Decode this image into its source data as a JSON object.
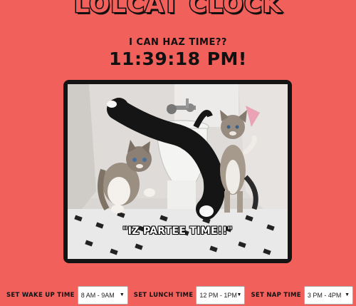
{
  "app": {
    "title": "LOLCAT CLOCK"
  },
  "header": {
    "subtitle": "I CAN HAZ TIME??",
    "time": "11:39:18 PM!"
  },
  "photo": {
    "caption": "\"IZ PARTEE TIME!!\""
  },
  "controls": {
    "wake": {
      "label": "SET WAKE UP TIME",
      "value": "8 AM - 9AM"
    },
    "lunch": {
      "label": "SET LUNCH TIME",
      "value": "12 PM - 1PM"
    },
    "nap": {
      "label": "SET NAP TIME",
      "value": "3 PM - 4PM"
    }
  },
  "colors": {
    "background": "#f2605b",
    "frame": "#141414",
    "text": "#111111"
  },
  "icons": {
    "select_arrow": "chevron-down-icon"
  }
}
